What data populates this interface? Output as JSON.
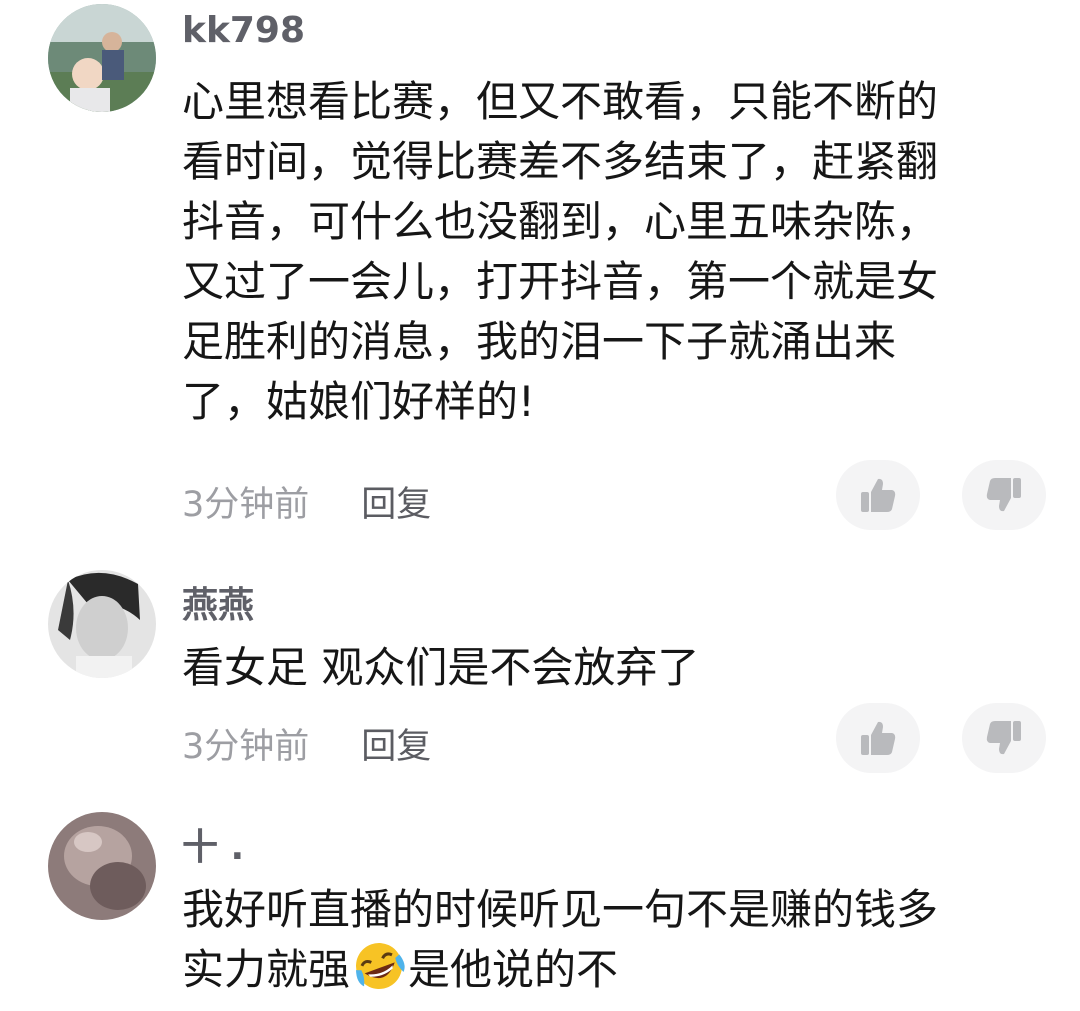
{
  "comments": [
    {
      "username": "kk798",
      "content_lines": [
        "心里想看比赛，但又不敢看，只能不断的",
        "看时间，觉得比赛差不多结束了，赶紧翻",
        "抖音，可什么也没翻到，心里五味杂陈，",
        "又过了一会儿，打开抖音，第一个就是女",
        "足胜利的消息，我的泪一下子就涌出来",
        "了，姑娘们好样的!"
      ],
      "time": "3分钟前",
      "reply_label": "回复"
    },
    {
      "username": "燕燕",
      "content_lines": [
        "看女足 观众们是不会放弃了"
      ],
      "time": "3分钟前",
      "reply_label": "回复"
    },
    {
      "username": "十 .",
      "content_lines": [
        "我好听直播的时候听见一句不是赚的钱多"
      ],
      "content_line2_before_emoji": "实力就强",
      "content_line2_emoji": "rofl-emoji",
      "content_line2_after_emoji": "是他说的不",
      "time": "",
      "reply_label": ""
    }
  ],
  "icons": {
    "like": "thumbs-up-icon",
    "dislike": "thumbs-down-icon"
  },
  "colors": {
    "username": "#5f6068",
    "text": "#161616",
    "meta": "#9d9ea3",
    "vote_bg": "#f4f4f5",
    "icon": "#b9babd"
  }
}
